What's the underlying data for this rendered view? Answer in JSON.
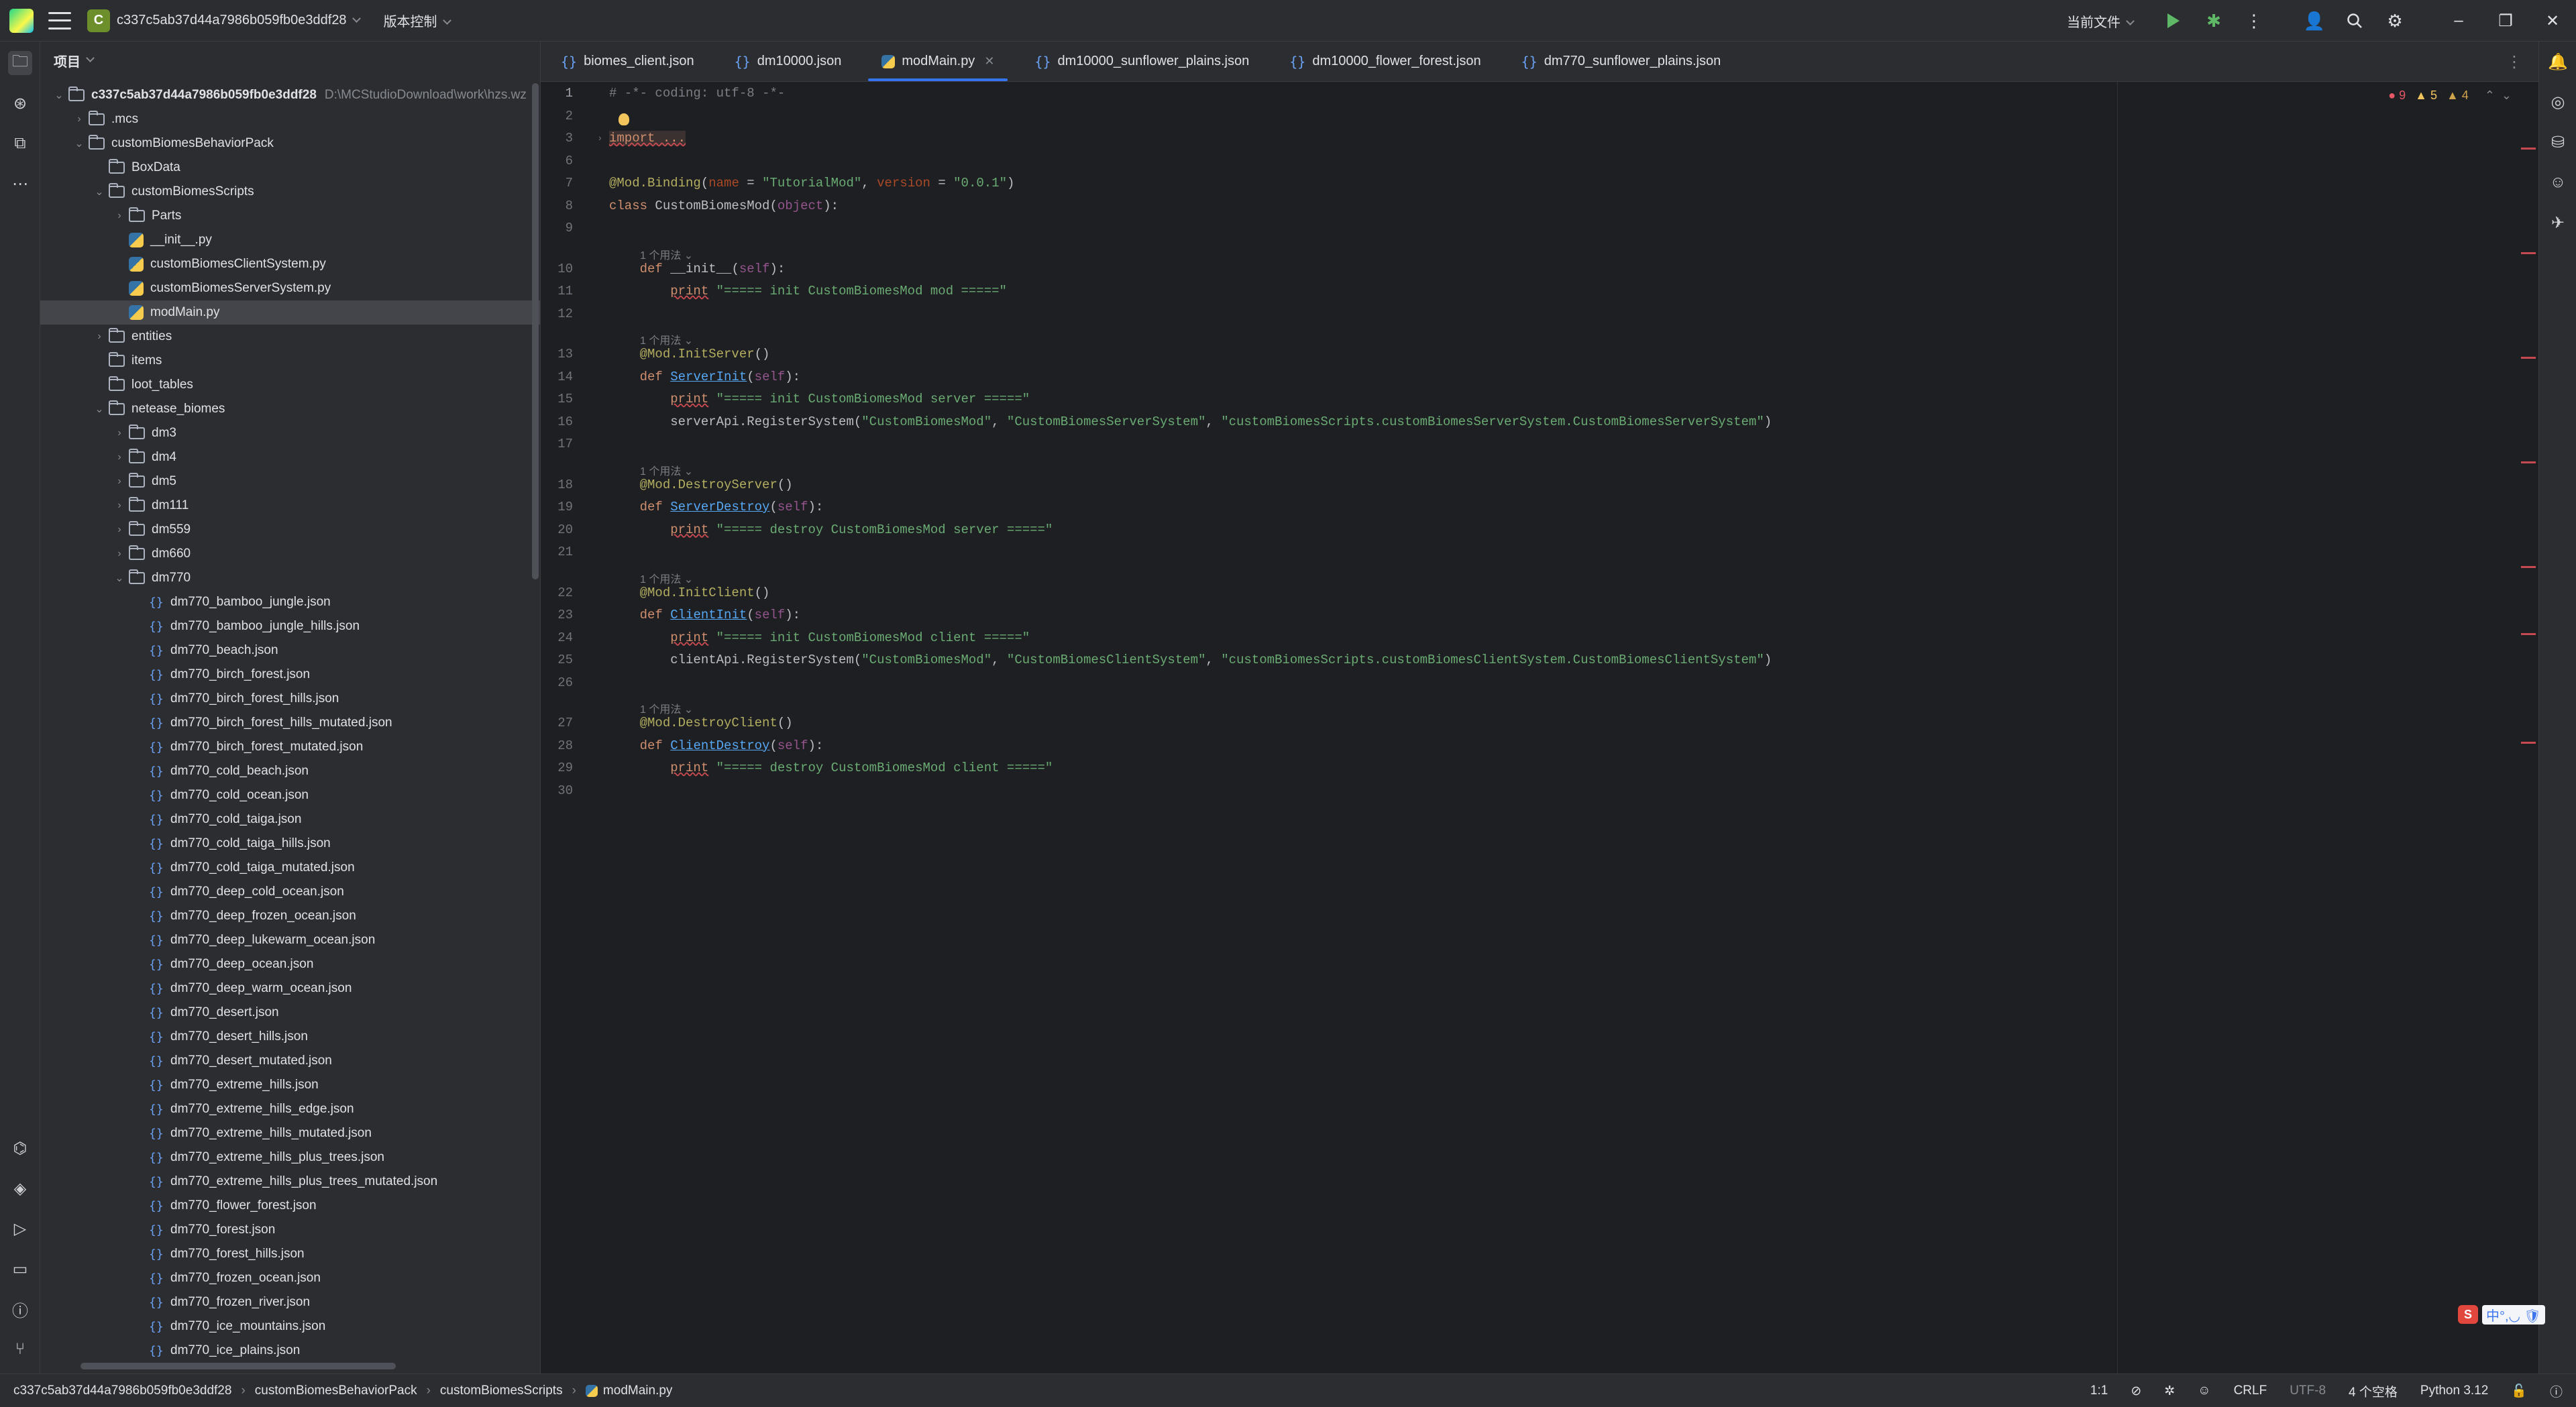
{
  "titlebar": {
    "project": "c337c5ab37d44a7986b059fb0e3ddf28",
    "project_badge": "C",
    "vcs": "版本控制",
    "run_config": "当前文件"
  },
  "project_panel": {
    "title": "项目",
    "tree": [
      {
        "label": "c337c5ab37d44a7986b059fb0e3ddf28",
        "hint": "D:\\MCStudioDownload\\work\\hzs.wz",
        "indent": 0,
        "arrow": "v",
        "kind": "folder",
        "bold": true
      },
      {
        "label": ".mcs",
        "indent": 1,
        "arrow": ">",
        "kind": "folder"
      },
      {
        "label": "customBiomesBehaviorPack",
        "indent": 1,
        "arrow": "v",
        "kind": "folder"
      },
      {
        "label": "BoxData",
        "indent": 2,
        "arrow": "",
        "kind": "folder"
      },
      {
        "label": "customBiomesScripts",
        "indent": 2,
        "arrow": "v",
        "kind": "folder"
      },
      {
        "label": "Parts",
        "indent": 3,
        "arrow": ">",
        "kind": "folder"
      },
      {
        "label": "__init__.py",
        "indent": 3,
        "arrow": "",
        "kind": "py"
      },
      {
        "label": "customBiomesClientSystem.py",
        "indent": 3,
        "arrow": "",
        "kind": "py"
      },
      {
        "label": "customBiomesServerSystem.py",
        "indent": 3,
        "arrow": "",
        "kind": "py"
      },
      {
        "label": "modMain.py",
        "indent": 3,
        "arrow": "",
        "kind": "py",
        "selected": true
      },
      {
        "label": "entities",
        "indent": 2,
        "arrow": ">",
        "kind": "folder"
      },
      {
        "label": "items",
        "indent": 2,
        "arrow": "",
        "kind": "folder"
      },
      {
        "label": "loot_tables",
        "indent": 2,
        "arrow": "",
        "kind": "folder"
      },
      {
        "label": "netease_biomes",
        "indent": 2,
        "arrow": "v",
        "kind": "folder"
      },
      {
        "label": "dm3",
        "indent": 3,
        "arrow": ">",
        "kind": "folder"
      },
      {
        "label": "dm4",
        "indent": 3,
        "arrow": ">",
        "kind": "folder"
      },
      {
        "label": "dm5",
        "indent": 3,
        "arrow": ">",
        "kind": "folder"
      },
      {
        "label": "dm111",
        "indent": 3,
        "arrow": ">",
        "kind": "folder"
      },
      {
        "label": "dm559",
        "indent": 3,
        "arrow": ">",
        "kind": "folder"
      },
      {
        "label": "dm660",
        "indent": 3,
        "arrow": ">",
        "kind": "folder"
      },
      {
        "label": "dm770",
        "indent": 3,
        "arrow": "v",
        "kind": "folder"
      },
      {
        "label": "dm770_bamboo_jungle.json",
        "indent": 4,
        "arrow": "",
        "kind": "json"
      },
      {
        "label": "dm770_bamboo_jungle_hills.json",
        "indent": 4,
        "arrow": "",
        "kind": "json"
      },
      {
        "label": "dm770_beach.json",
        "indent": 4,
        "arrow": "",
        "kind": "json"
      },
      {
        "label": "dm770_birch_forest.json",
        "indent": 4,
        "arrow": "",
        "kind": "json"
      },
      {
        "label": "dm770_birch_forest_hills.json",
        "indent": 4,
        "arrow": "",
        "kind": "json"
      },
      {
        "label": "dm770_birch_forest_hills_mutated.json",
        "indent": 4,
        "arrow": "",
        "kind": "json"
      },
      {
        "label": "dm770_birch_forest_mutated.json",
        "indent": 4,
        "arrow": "",
        "kind": "json"
      },
      {
        "label": "dm770_cold_beach.json",
        "indent": 4,
        "arrow": "",
        "kind": "json"
      },
      {
        "label": "dm770_cold_ocean.json",
        "indent": 4,
        "arrow": "",
        "kind": "json"
      },
      {
        "label": "dm770_cold_taiga.json",
        "indent": 4,
        "arrow": "",
        "kind": "json"
      },
      {
        "label": "dm770_cold_taiga_hills.json",
        "indent": 4,
        "arrow": "",
        "kind": "json"
      },
      {
        "label": "dm770_cold_taiga_mutated.json",
        "indent": 4,
        "arrow": "",
        "kind": "json"
      },
      {
        "label": "dm770_deep_cold_ocean.json",
        "indent": 4,
        "arrow": "",
        "kind": "json"
      },
      {
        "label": "dm770_deep_frozen_ocean.json",
        "indent": 4,
        "arrow": "",
        "kind": "json"
      },
      {
        "label": "dm770_deep_lukewarm_ocean.json",
        "indent": 4,
        "arrow": "",
        "kind": "json"
      },
      {
        "label": "dm770_deep_ocean.json",
        "indent": 4,
        "arrow": "",
        "kind": "json"
      },
      {
        "label": "dm770_deep_warm_ocean.json",
        "indent": 4,
        "arrow": "",
        "kind": "json"
      },
      {
        "label": "dm770_desert.json",
        "indent": 4,
        "arrow": "",
        "kind": "json"
      },
      {
        "label": "dm770_desert_hills.json",
        "indent": 4,
        "arrow": "",
        "kind": "json"
      },
      {
        "label": "dm770_desert_mutated.json",
        "indent": 4,
        "arrow": "",
        "kind": "json"
      },
      {
        "label": "dm770_extreme_hills.json",
        "indent": 4,
        "arrow": "",
        "kind": "json"
      },
      {
        "label": "dm770_extreme_hills_edge.json",
        "indent": 4,
        "arrow": "",
        "kind": "json"
      },
      {
        "label": "dm770_extreme_hills_mutated.json",
        "indent": 4,
        "arrow": "",
        "kind": "json"
      },
      {
        "label": "dm770_extreme_hills_plus_trees.json",
        "indent": 4,
        "arrow": "",
        "kind": "json"
      },
      {
        "label": "dm770_extreme_hills_plus_trees_mutated.json",
        "indent": 4,
        "arrow": "",
        "kind": "json"
      },
      {
        "label": "dm770_flower_forest.json",
        "indent": 4,
        "arrow": "",
        "kind": "json"
      },
      {
        "label": "dm770_forest.json",
        "indent": 4,
        "arrow": "",
        "kind": "json"
      },
      {
        "label": "dm770_forest_hills.json",
        "indent": 4,
        "arrow": "",
        "kind": "json"
      },
      {
        "label": "dm770_frozen_ocean.json",
        "indent": 4,
        "arrow": "",
        "kind": "json"
      },
      {
        "label": "dm770_frozen_river.json",
        "indent": 4,
        "arrow": "",
        "kind": "json"
      },
      {
        "label": "dm770_ice_mountains.json",
        "indent": 4,
        "arrow": "",
        "kind": "json"
      },
      {
        "label": "dm770_ice_plains.json",
        "indent": 4,
        "arrow": "",
        "kind": "json"
      }
    ]
  },
  "tabs": [
    {
      "label": "biomes_client.json",
      "kind": "json",
      "active": false
    },
    {
      "label": "dm10000.json",
      "kind": "json",
      "active": false
    },
    {
      "label": "modMain.py",
      "kind": "py",
      "active": true
    },
    {
      "label": "dm10000_sunflower_plains.json",
      "kind": "json",
      "active": false
    },
    {
      "label": "dm10000_flower_forest.json",
      "kind": "json",
      "active": false
    },
    {
      "label": "dm770_sunflower_plains.json",
      "kind": "json",
      "active": false
    }
  ],
  "inspection": {
    "errors": "9",
    "warnings": "5",
    "weak_warnings": "4"
  },
  "editor": {
    "lines": [
      {
        "n": "1",
        "text": "# -*- coding: utf-8 -*-",
        "cls": "comment"
      },
      {
        "n": "2",
        "text": "",
        "cls": ""
      },
      {
        "n": "3",
        "text": "import ...",
        "cls": "import"
      },
      {
        "n": "6",
        "text": "",
        "cls": ""
      },
      {
        "n": "7",
        "text": "@Mod.Binding(name = \"TutorialMod\", version = \"0.0.1\")",
        "cls": "deco"
      },
      {
        "n": "8",
        "text": "class CustomBiomesMod(object):",
        "cls": "class"
      },
      {
        "n": "9",
        "text": "",
        "cls": ""
      },
      {
        "hint": "1 个用法 ⌄"
      },
      {
        "n": "10",
        "text": "    def __init__(self):",
        "cls": "def"
      },
      {
        "n": "11",
        "text": "        print \"===== init CustomBiomesMod mod =====\"",
        "cls": "print"
      },
      {
        "n": "12",
        "text": "",
        "cls": ""
      },
      {
        "hint": "1 个用法 ⌄"
      },
      {
        "n": "13",
        "text": "    @Mod.InitServer()",
        "cls": "deco"
      },
      {
        "n": "14",
        "text": "    def ServerInit(self):",
        "cls": "def"
      },
      {
        "n": "15",
        "text": "        print \"===== init CustomBiomesMod server =====\"",
        "cls": "print"
      },
      {
        "n": "16",
        "text": "        serverApi.RegisterSystem(\"CustomBiomesMod\", \"CustomBiomesServerSystem\", \"customBiomesScripts.customBiomesServerSystem.CustomBiomesServerSystem\")",
        "cls": "plain"
      },
      {
        "n": "17",
        "text": "",
        "cls": ""
      },
      {
        "hint": "1 个用法 ⌄"
      },
      {
        "n": "18",
        "text": "    @Mod.DestroyServer()",
        "cls": "deco"
      },
      {
        "n": "19",
        "text": "    def ServerDestroy(self):",
        "cls": "def"
      },
      {
        "n": "20",
        "text": "        print \"===== destroy CustomBiomesMod server =====\"",
        "cls": "print"
      },
      {
        "n": "21",
        "text": "",
        "cls": ""
      },
      {
        "hint": "1 个用法 ⌄"
      },
      {
        "n": "22",
        "text": "    @Mod.InitClient()",
        "cls": "deco"
      },
      {
        "n": "23",
        "text": "    def ClientInit(self):",
        "cls": "def"
      },
      {
        "n": "24",
        "text": "        print \"===== init CustomBiomesMod client =====\"",
        "cls": "print"
      },
      {
        "n": "25",
        "text": "        clientApi.RegisterSystem(\"CustomBiomesMod\", \"CustomBiomesClientSystem\", \"customBiomesScripts.customBiomesClientSystem.CustomBiomesClientSystem\")",
        "cls": "plain"
      },
      {
        "n": "26",
        "text": "",
        "cls": ""
      },
      {
        "hint": "1 个用法 ⌄"
      },
      {
        "n": "27",
        "text": "    @Mod.DestroyClient()",
        "cls": "deco"
      },
      {
        "n": "28",
        "text": "    def ClientDestroy(self):",
        "cls": "def"
      },
      {
        "n": "29",
        "text": "        print \"===== destroy CustomBiomesMod client =====\"",
        "cls": "print"
      },
      {
        "n": "30",
        "text": "",
        "cls": ""
      }
    ]
  },
  "statusbar": {
    "breadcrumb": [
      "c337c5ab37d44a7986b059fb0e3ddf28",
      "customBiomesBehaviorPack",
      "customBiomesScripts",
      "modMain.py"
    ],
    "position": "1:1",
    "line_sep": "CRLF",
    "encoding": "UTF-8",
    "indent": "4 个空格",
    "interpreter": "Python 3.12"
  },
  "ime": {
    "badge": "S",
    "text": "中°,◡ 🛡"
  }
}
